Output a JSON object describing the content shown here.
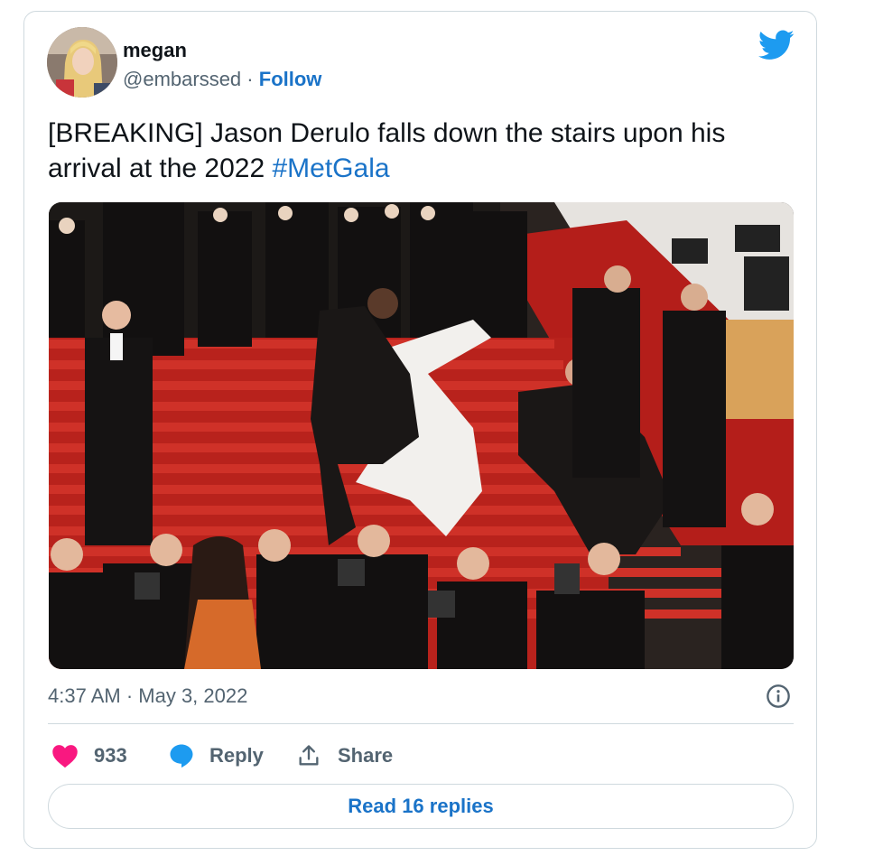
{
  "user": {
    "name": "megan",
    "handle": "@embarssed",
    "separator": "·",
    "follow_label": "Follow",
    "avatar_icon": "profile-avatar"
  },
  "tweet": {
    "text_before": "[BREAKING] Jason Derulo falls down the stairs upon his arrival at the 2022 ",
    "hashtag": "#MetGala",
    "image_subject": "man in white suit falling on red carpet stairs surrounded by photographers",
    "timestamp": "4:37 AM · May 3, 2022"
  },
  "actions": {
    "like_count": "933",
    "reply_label": "Reply",
    "share_label": "Share"
  },
  "read_replies_label": "Read 16 replies",
  "colors": {
    "accent": "#1a73c8",
    "like": "#f91880",
    "twitter_blue": "#1d9bf0",
    "muted_text": "#536471",
    "carpet_red": "#c9261e"
  },
  "icons": [
    "twitter-bird-icon",
    "info-icon",
    "heart-icon",
    "reply-bubble-icon",
    "share-icon"
  ]
}
